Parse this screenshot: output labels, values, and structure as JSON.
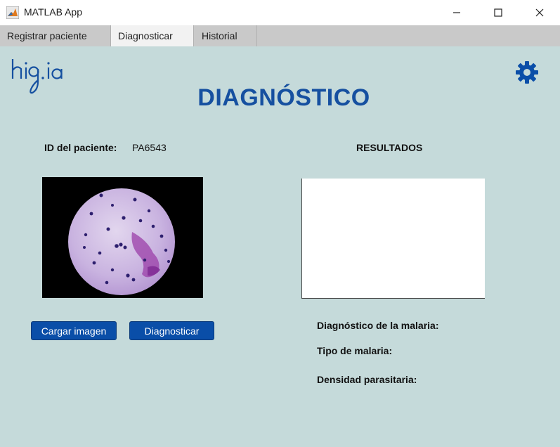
{
  "window": {
    "title": "MATLAB App",
    "controls": {
      "minimize": "—",
      "maximize": "☐",
      "close": "✕"
    }
  },
  "tabs": [
    {
      "label": "Registrar paciente",
      "active": false
    },
    {
      "label": "Diagnosticar",
      "active": true
    },
    {
      "label": "Historial",
      "active": false
    }
  ],
  "logo": {
    "text": "hig.ia"
  },
  "header": {
    "title": "DIAGNÓSTICO"
  },
  "patient": {
    "id_label": "ID del paciente:",
    "id_value": "PA6543"
  },
  "results": {
    "title": "RESULTADOS",
    "malaria_diagnosis_label": "Diagnóstico de la malaria:",
    "malaria_type_label": "Tipo de malaria:",
    "parasite_density_label": "Densidad parasitaria:"
  },
  "buttons": {
    "load_image": "Cargar imagen",
    "diagnose": "Diagnosticar"
  },
  "icons": {
    "app": "matlab-icon",
    "settings": "gear-icon"
  },
  "colors": {
    "panel_bg": "#c5dada",
    "accent": "#1650a0",
    "button": "#0a4ea8",
    "tab_bar": "#c9c9c9"
  }
}
